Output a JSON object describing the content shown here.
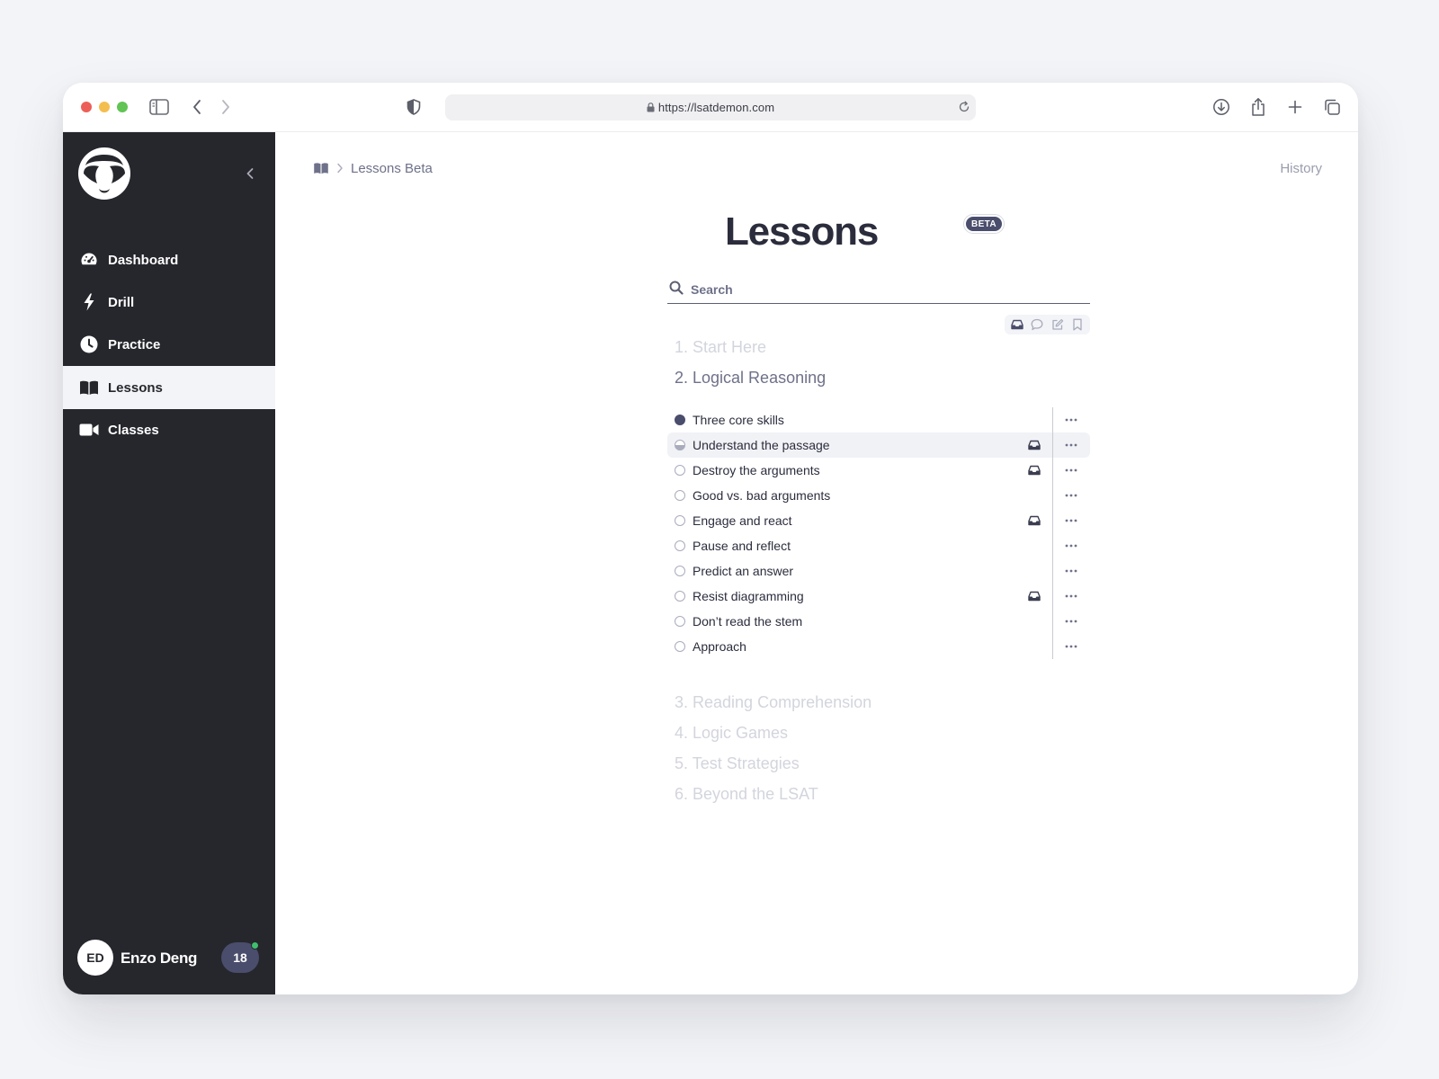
{
  "browser": {
    "url": "https://lsatdemon.com"
  },
  "sidebar": {
    "items": [
      {
        "label": "Dashboard",
        "icon": "speedometer-icon"
      },
      {
        "label": "Drill",
        "icon": "lightning-icon"
      },
      {
        "label": "Practice",
        "icon": "clock-icon"
      },
      {
        "label": "Lessons",
        "icon": "book-icon",
        "active": true
      },
      {
        "label": "Classes",
        "icon": "video-camera-icon"
      }
    ],
    "user": {
      "initials": "ED",
      "name": "Enzo Deng",
      "count": "18"
    }
  },
  "header": {
    "breadcrumb": "Lessons Beta",
    "history": "History"
  },
  "page": {
    "title": "Lessons",
    "badge": "BETA",
    "search_placeholder": "Search"
  },
  "sections": [
    {
      "label": "1. Start Here"
    },
    {
      "label": "2. Logical Reasoning",
      "open": true
    },
    {
      "label": "3. Reading Comprehension"
    },
    {
      "label": "4. Logic Games"
    },
    {
      "label": "5. Test Strategies"
    },
    {
      "label": "6. Beyond the LSAT"
    }
  ],
  "lessons": [
    {
      "title": "Three core skills",
      "status": "done",
      "tag": false
    },
    {
      "title": "Understand the passage",
      "status": "in-progress",
      "tag": true
    },
    {
      "title": "Destroy the arguments",
      "status": "not-started",
      "tag": true
    },
    {
      "title": "Good vs. bad arguments",
      "status": "not-started",
      "tag": false
    },
    {
      "title": "Engage and react",
      "status": "not-started",
      "tag": true
    },
    {
      "title": "Pause and reflect",
      "status": "not-started",
      "tag": false
    },
    {
      "title": "Predict an answer",
      "status": "not-started",
      "tag": false
    },
    {
      "title": "Resist diagramming",
      "status": "not-started",
      "tag": true
    },
    {
      "title": "Don’t read the stem",
      "status": "not-started",
      "tag": false
    },
    {
      "title": "Approach",
      "status": "not-started",
      "tag": false
    }
  ],
  "colors": {
    "sidebar_bg": "#26272d",
    "accent": "#4a4d6b",
    "online": "#3fbf6e"
  }
}
